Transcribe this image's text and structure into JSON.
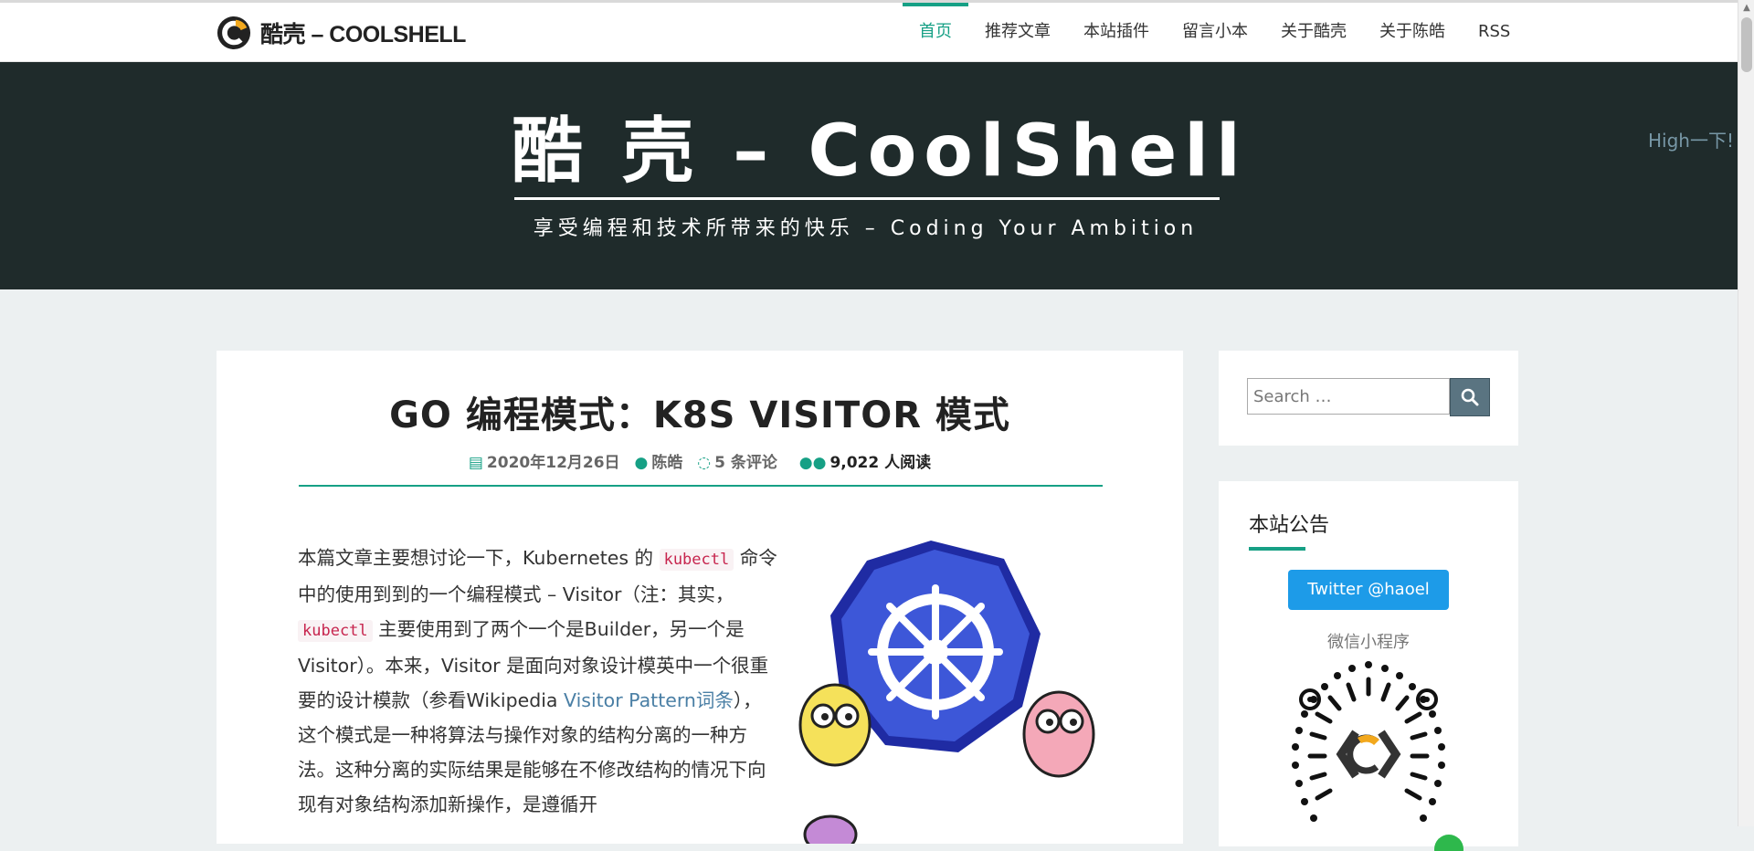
{
  "brand": {
    "name": "酷壳 – COOLSHELL"
  },
  "nav": {
    "items": [
      "首页",
      "推荐文章",
      "本站插件",
      "留言小本",
      "关于酷壳",
      "关于陈皓",
      "RSS"
    ],
    "active_index": 0
  },
  "hero": {
    "title": "酷 壳 – CoolShell",
    "subtitle": "享受编程和技术所带来的快乐 – Coding Your Ambition",
    "high_link": "High一下!"
  },
  "post": {
    "title": "GO 编程模式：K8S VISITOR 模式",
    "date": "2020年12月26日",
    "author": "陈皓",
    "comments": "5 条评论",
    "reads": "9,022 人阅读",
    "body": {
      "p1": "本篇文章主要想讨论一下，Kubernetes 的 ",
      "code1": "kubectl",
      "p2": " 命令中的使用到到的一个编程模式 – Visitor（注：其实，",
      "code2": "kubectl",
      "p3": " 主要使用到了两个一个是Builder，另一个是Visitor）。本来，Visitor 是面向对象设计模英中一个很重要的设计模款（参看Wikipedia ",
      "link": "Visitor Pattern词条",
      "p4": "），这个模式是一种将算法与操作对象的结构分离的一种方法。这种分离的实际结果是能够在不修改结构的情况下向现有对象结构添加新操作，是遵循开"
    }
  },
  "sidebar": {
    "search_placeholder": "Search …",
    "notice_title": "本站公告",
    "twitter_label": "Twitter @haoel",
    "mini_program_label": "微信小程序"
  },
  "colors": {
    "accent": "#16a085",
    "hero_bg": "#1f2b2b",
    "twitter": "#1d9be8"
  }
}
